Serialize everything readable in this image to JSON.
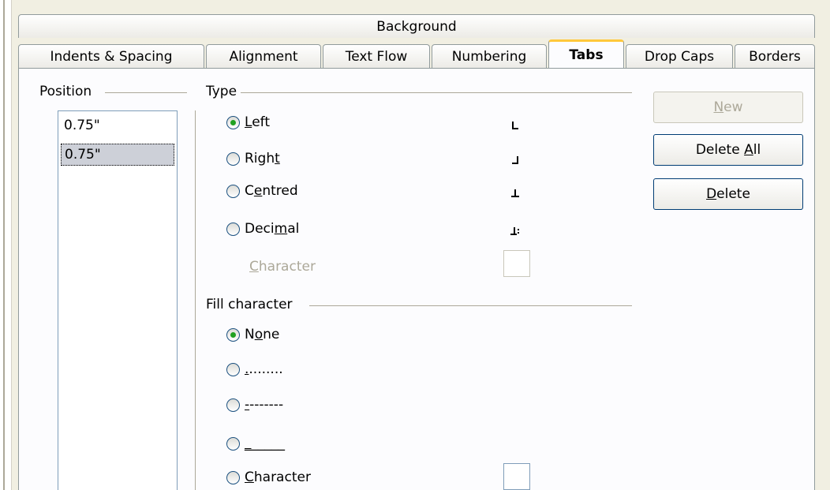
{
  "tabs_top": [
    {
      "label": "Background"
    }
  ],
  "tabs": [
    {
      "label": "Indents & Spacing"
    },
    {
      "label": "Alignment"
    },
    {
      "label": "Text Flow"
    },
    {
      "label": "Numbering"
    },
    {
      "label": "Tabs"
    },
    {
      "label": "Drop Caps"
    },
    {
      "label": "Borders"
    }
  ],
  "position": {
    "title": "Position",
    "input_value": "0.75\"",
    "list": [
      "0.75\""
    ]
  },
  "type": {
    "title": "Type",
    "options": [
      {
        "pre": "",
        "key": "L",
        "post": "eft",
        "selected": true,
        "icon": "left-tab-icon"
      },
      {
        "pre": "Righ",
        "key": "t",
        "post": "",
        "selected": false,
        "icon": "right-tab-icon"
      },
      {
        "pre": "C",
        "key": "e",
        "post": "ntred",
        "selected": false,
        "icon": "centred-tab-icon"
      },
      {
        "pre": "Deci",
        "key": "m",
        "post": "al",
        "selected": false,
        "icon": "decimal-tab-icon"
      }
    ],
    "character_label": {
      "key": "C",
      "post": "haracter"
    }
  },
  "fill": {
    "title": "Fill character",
    "none": {
      "pre": "N",
      "key": "o",
      "post": "ne"
    },
    "dots": {
      "key": ".",
      "post": "........"
    },
    "dashes": {
      "key": "-",
      "post": "-------"
    },
    "underline": {
      "key": "_",
      "post": "_____"
    },
    "character": {
      "key": "C",
      "post": "haracter"
    }
  },
  "buttons": {
    "new": {
      "key": "N",
      "post": "ew"
    },
    "delete_all": {
      "pre": "Delete ",
      "key": "A",
      "post": "ll"
    },
    "delete": {
      "key": "D",
      "post": "elete"
    }
  },
  "colors": {
    "active_tab_accent": "#ffc83c",
    "radio_selected": "#21a121",
    "list_selection": "#cdd0d8"
  }
}
